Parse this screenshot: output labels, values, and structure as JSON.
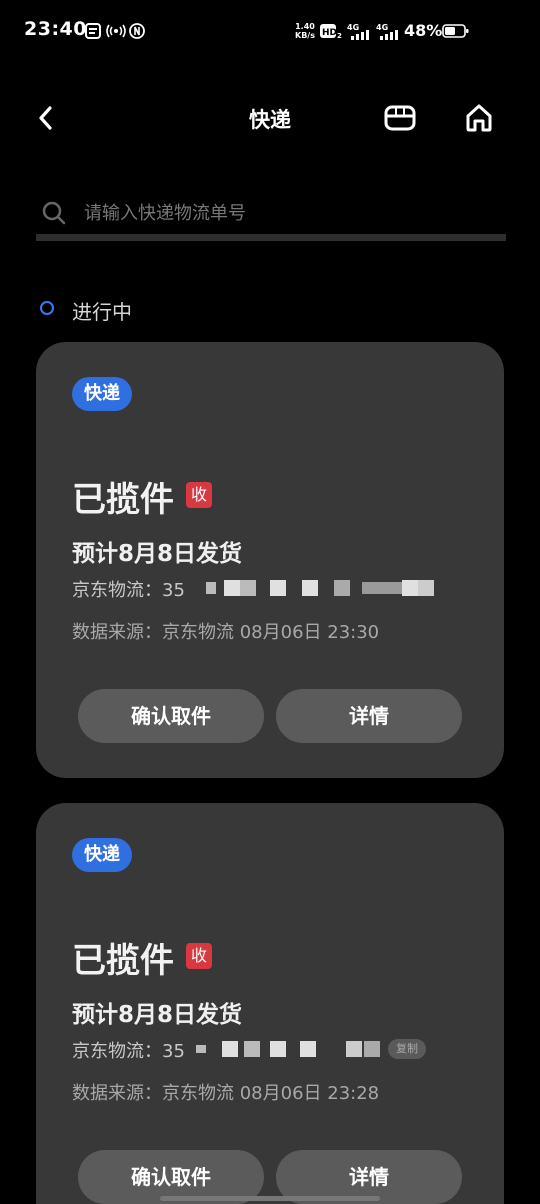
{
  "status_bar": {
    "time": "23:40",
    "net_speed_value": "1.40",
    "net_speed_unit": "KB/s",
    "battery_percent": "48%",
    "signal_1": "4G",
    "signal_2": "4G",
    "hd_label": "HD"
  },
  "header": {
    "title": "快递"
  },
  "search": {
    "placeholder": "请输入快递物流单号"
  },
  "section": {
    "title": "进行中"
  },
  "cards": [
    {
      "type_tag": "快递",
      "status": "已揽件",
      "receive_badge": "收",
      "eta": "预计8月8日发货",
      "tracking_label": "京东物流：",
      "tracking_number_visible": "35",
      "source": "数据来源：京东物流 08月06日 23:30",
      "confirm_button": "确认取件",
      "detail_button": "详情"
    },
    {
      "type_tag": "快递",
      "status": "已揽件",
      "receive_badge": "收",
      "eta": "预计8月8日发货",
      "tracking_label": "京东物流：",
      "tracking_number_visible": "35",
      "copy_label": "复制",
      "source": "数据来源：京东物流 08月06日 23:28",
      "confirm_button": "确认取件",
      "detail_button": "详情"
    }
  ]
}
